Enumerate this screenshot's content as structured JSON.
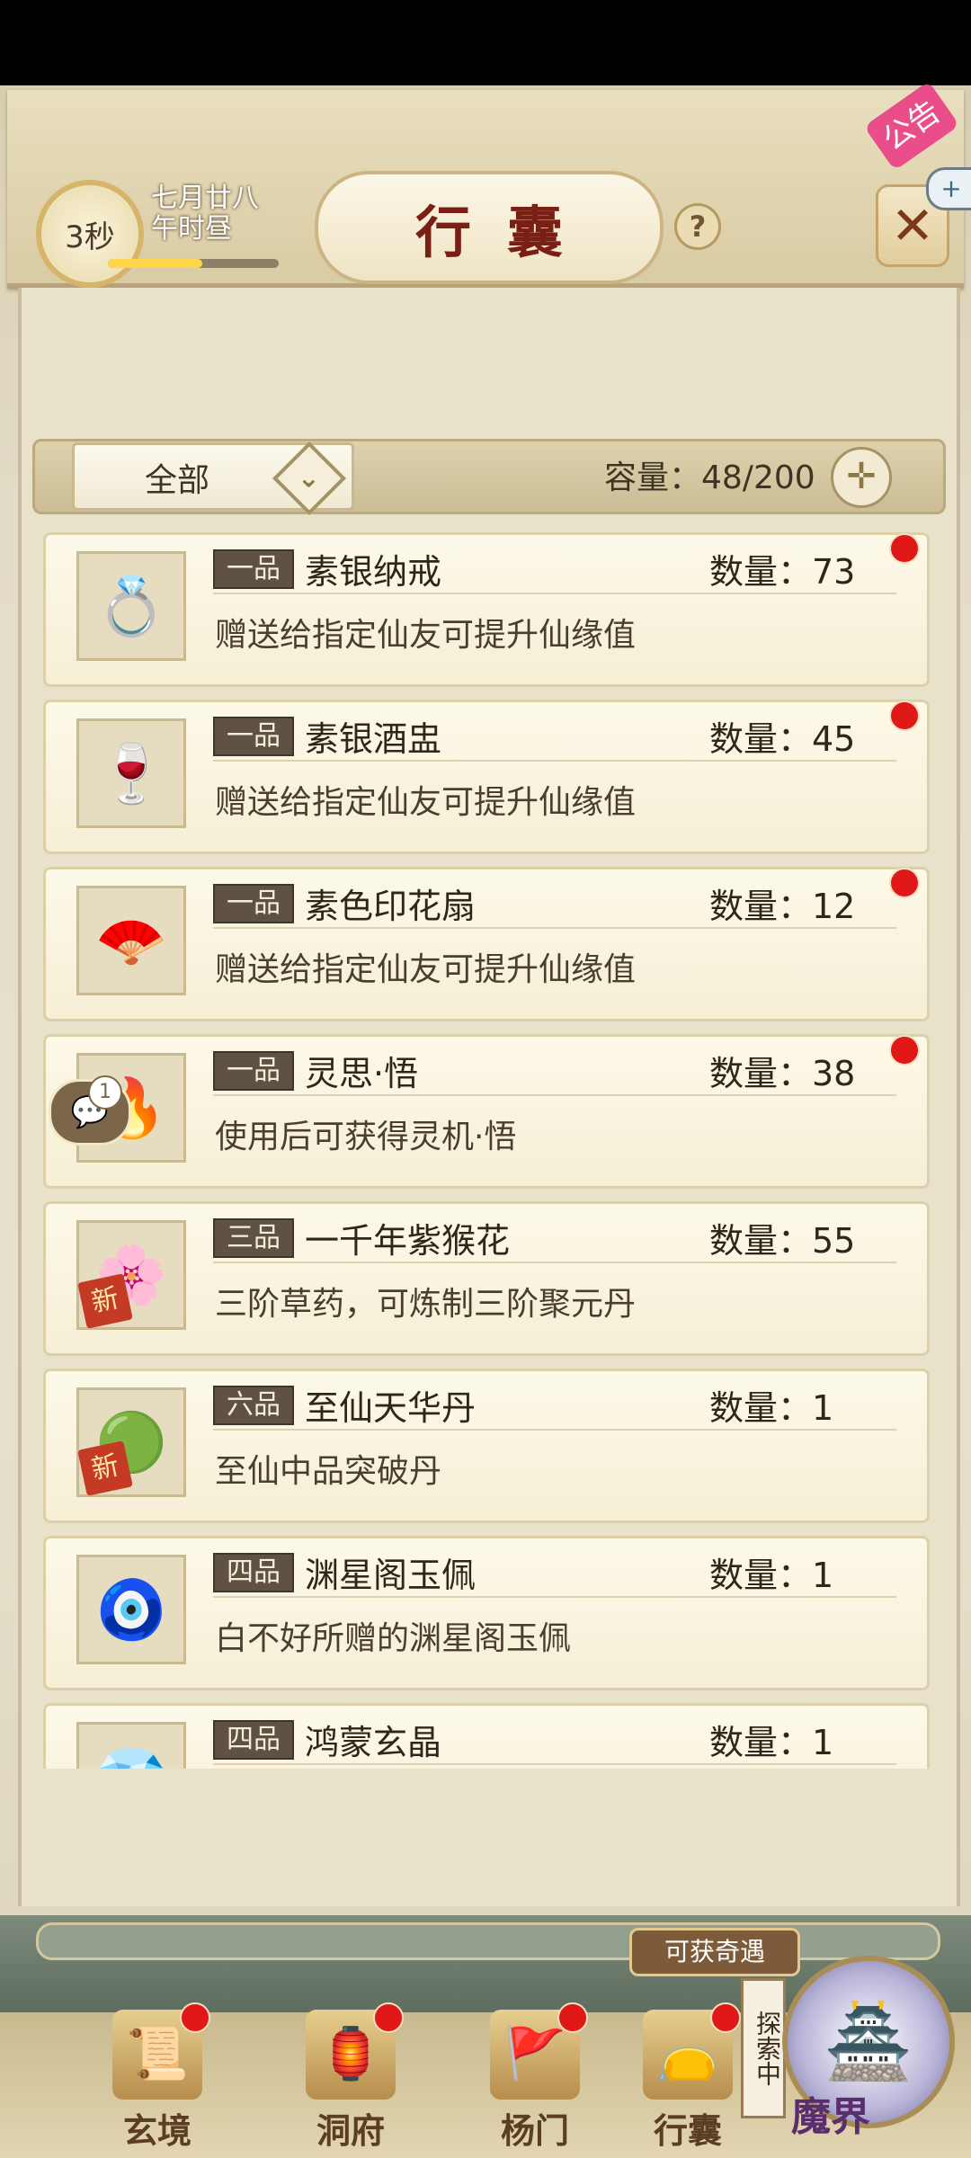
{
  "header": {
    "timer": "3秒",
    "date_line1": "七月廿八",
    "date_line2": "午时昼",
    "day_progress": 0.55,
    "title": "行囊",
    "help": "?",
    "notice": "公告"
  },
  "filter": {
    "selected": "全部",
    "capacity": "容量：48/200"
  },
  "items": [
    {
      "grade": "一品",
      "name": "素银纳戒",
      "count": "数量：73",
      "desc": "赠送给指定仙友可提升仙缘值",
      "icon": "ring-icon",
      "glyph": "💍",
      "red_dot": true,
      "new": false
    },
    {
      "grade": "一品",
      "name": "素银酒盅",
      "count": "数量：45",
      "desc": "赠送给指定仙友可提升仙缘值",
      "icon": "goblet-icon",
      "glyph": "🍷",
      "red_dot": true,
      "new": false
    },
    {
      "grade": "一品",
      "name": "素色印花扇",
      "count": "数量：12",
      "desc": "赠送给指定仙友可提升仙缘值",
      "icon": "fan-icon",
      "glyph": "🪭",
      "red_dot": true,
      "new": false
    },
    {
      "grade": "一品",
      "name": "灵思·悟",
      "count": "数量：38",
      "desc": "使用后可获得灵机·悟",
      "icon": "spirit-flame-icon",
      "glyph": "🔥",
      "red_dot": true,
      "new": false
    },
    {
      "grade": "三品",
      "name": "一千年紫猴花",
      "count": "数量：55",
      "desc": "三阶草药，可炼制三阶聚元丹",
      "icon": "flower-icon",
      "glyph": "🌸",
      "red_dot": false,
      "new": true
    },
    {
      "grade": "六品",
      "name": "至仙天华丹",
      "count": "数量：1",
      "desc": "至仙中品突破丹",
      "icon": "pill-icon",
      "glyph": "🟢",
      "red_dot": false,
      "new": true
    },
    {
      "grade": "四品",
      "name": "渊星阁玉佩",
      "count": "数量：1",
      "desc": "白不好所赠的渊星阁玉佩",
      "icon": "jade-pendant-icon",
      "glyph": "🧿",
      "red_dot": false,
      "new": false
    },
    {
      "grade": "四品",
      "name": "鸿蒙玄晶",
      "count": "数量：1",
      "desc": "",
      "icon": "crystal-icon",
      "glyph": "💎",
      "red_dot": false,
      "new": false
    }
  ],
  "new_tag": "新",
  "chat_badge": "1",
  "nav": {
    "qiyu": "可获奇遇",
    "explore": "探索中",
    "items": [
      {
        "label": "玄境",
        "glyph": "📜"
      },
      {
        "label": "洞府",
        "glyph": "🏮"
      },
      {
        "label": "杨门",
        "glyph": "🚩"
      },
      {
        "label": "行囊",
        "glyph": "👝"
      }
    ],
    "mojie": "魔界"
  }
}
